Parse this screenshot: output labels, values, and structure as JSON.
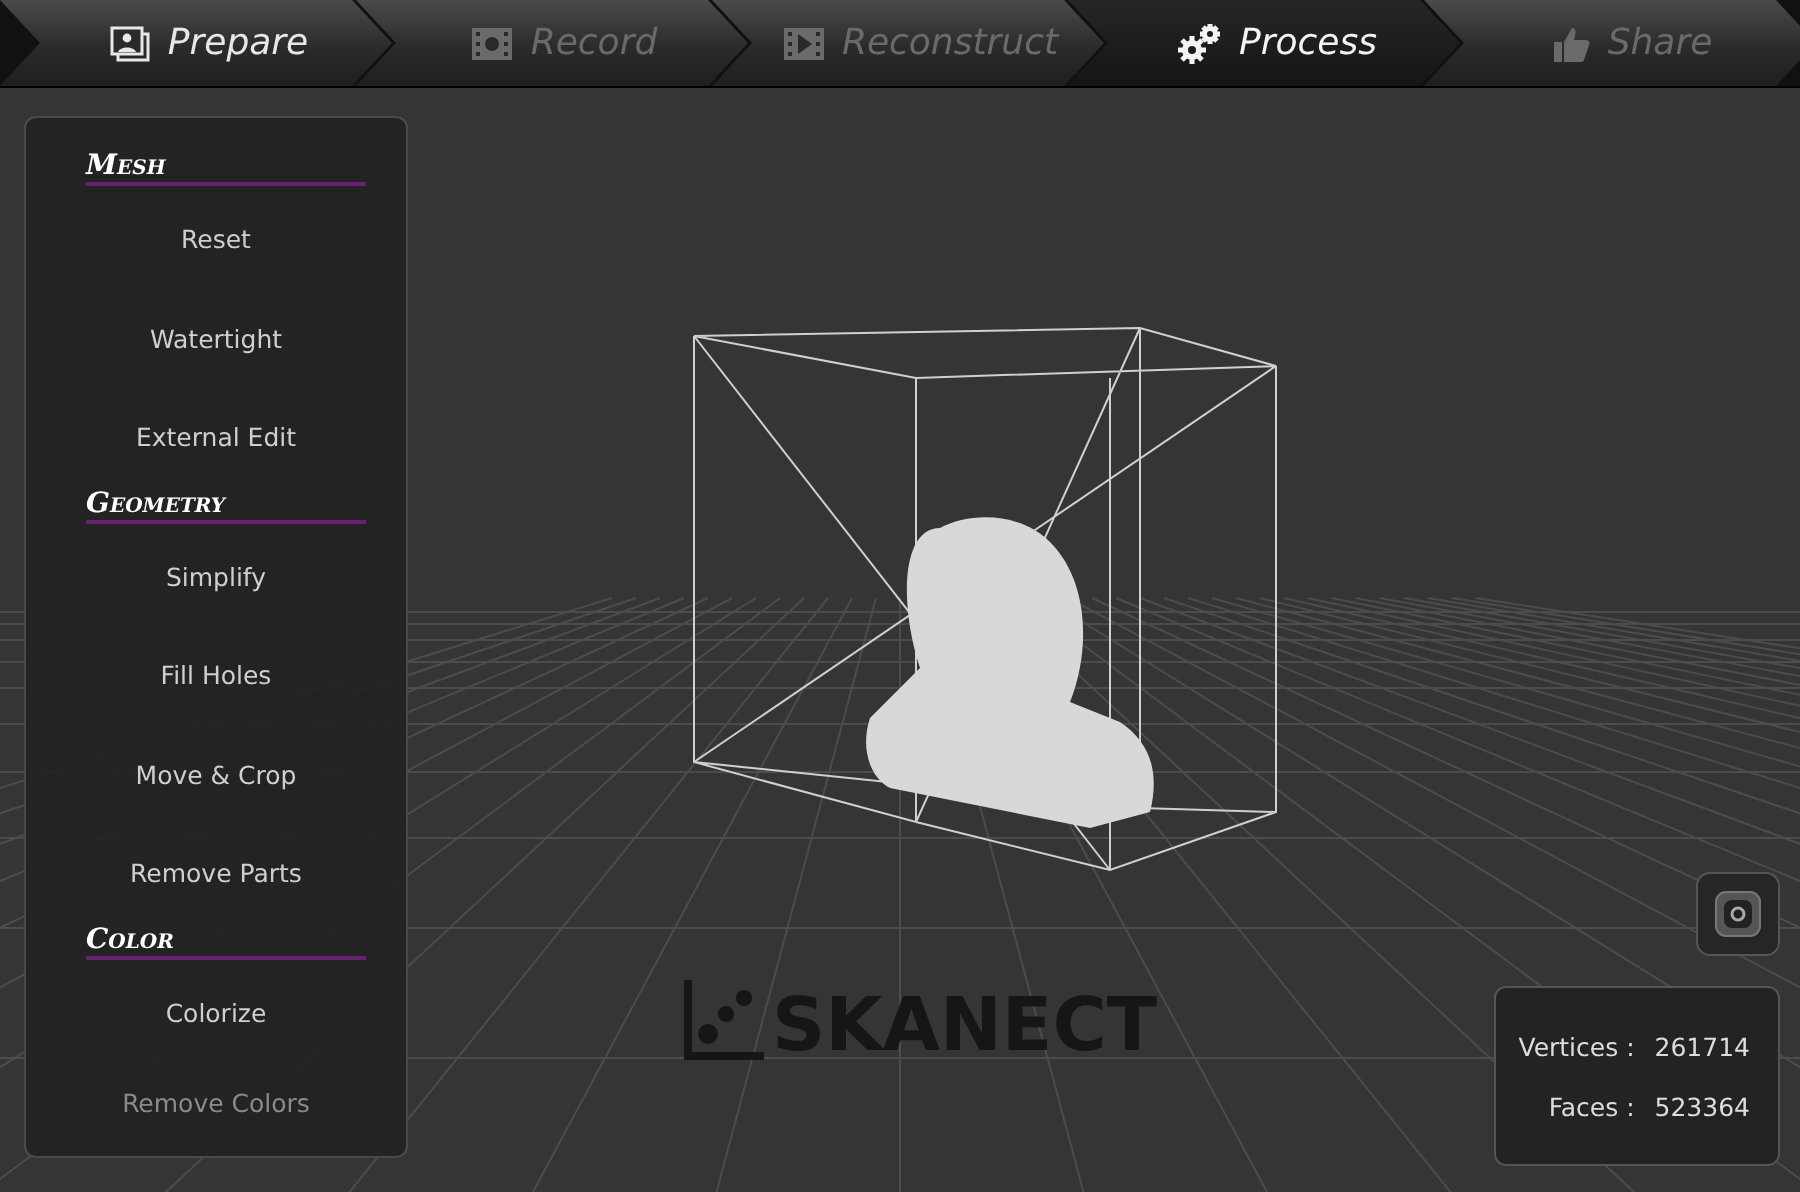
{
  "tabs": [
    {
      "label": "Prepare",
      "selected": false,
      "disabled": false
    },
    {
      "label": "Record",
      "selected": false,
      "disabled": true
    },
    {
      "label": "Reconstruct",
      "selected": false,
      "disabled": true
    },
    {
      "label": "Process",
      "selected": true,
      "disabled": false
    },
    {
      "label": "Share",
      "selected": false,
      "disabled": true
    }
  ],
  "sidebar": {
    "sections": [
      {
        "title": "Mesh",
        "items": [
          "Reset",
          "Watertight",
          "External Edit"
        ]
      },
      {
        "title": "Geometry",
        "items": [
          "Simplify",
          "Fill Holes",
          "Move & Crop",
          "Remove Parts"
        ]
      },
      {
        "title": "Color",
        "items": [
          "Colorize",
          "Remove Colors"
        ]
      }
    ]
  },
  "logo": "SKANECT",
  "stats": [
    {
      "label": "Vertices :",
      "value": "261714"
    },
    {
      "label": "Faces :",
      "value": "523364"
    }
  ]
}
